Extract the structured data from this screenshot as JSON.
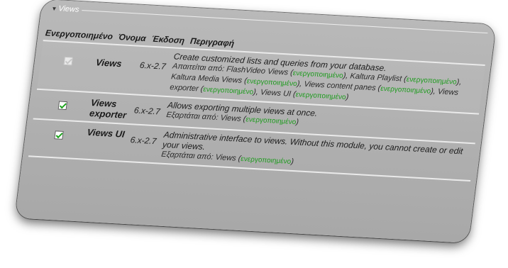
{
  "fieldset": {
    "legend": "Views"
  },
  "table": {
    "headers": {
      "enabled": "Ενεργοποιημένο",
      "name": "Όνομα",
      "version": "Έκδοση",
      "description": "Περιγραφή"
    },
    "rows": [
      {
        "checked": true,
        "disabled": true,
        "name": "Views",
        "version": "6.x-2.7",
        "description": "Create customized lists and queries from your database.",
        "dep_label": "Απαιτείται από:",
        "deps": [
          {
            "name": "FlashVideo Views",
            "status": "ενεργοποιημένο"
          },
          {
            "name": "Kaltura Playlist",
            "status": "ενεργοποιημένο"
          },
          {
            "name": "Kaltura Media Views",
            "status": "ενεργοποιημένο"
          },
          {
            "name": "Views content panes",
            "status": "ενεργοποιημένο"
          },
          {
            "name": "Views exporter",
            "status": "ενεργοποιημένο"
          },
          {
            "name": "Views UI",
            "status": "ενεργοποιημένο"
          }
        ]
      },
      {
        "checked": true,
        "disabled": false,
        "name": "Views exporter",
        "version": "6.x-2.7",
        "description": "Allows exporting multiple views at once.",
        "dep_label": "Εξαρτάται από:",
        "deps": [
          {
            "name": "Views",
            "status": "ενεργοποιημένο"
          }
        ]
      },
      {
        "checked": true,
        "disabled": false,
        "name": "Views UI",
        "version": "6.x-2.7",
        "description": "Administrative interface to views. Without this module, you cannot create or edit your views.",
        "dep_label": "Εξαρτάται από:",
        "deps": [
          {
            "name": "Views",
            "status": "ενεργοποιημένο"
          }
        ]
      }
    ]
  }
}
